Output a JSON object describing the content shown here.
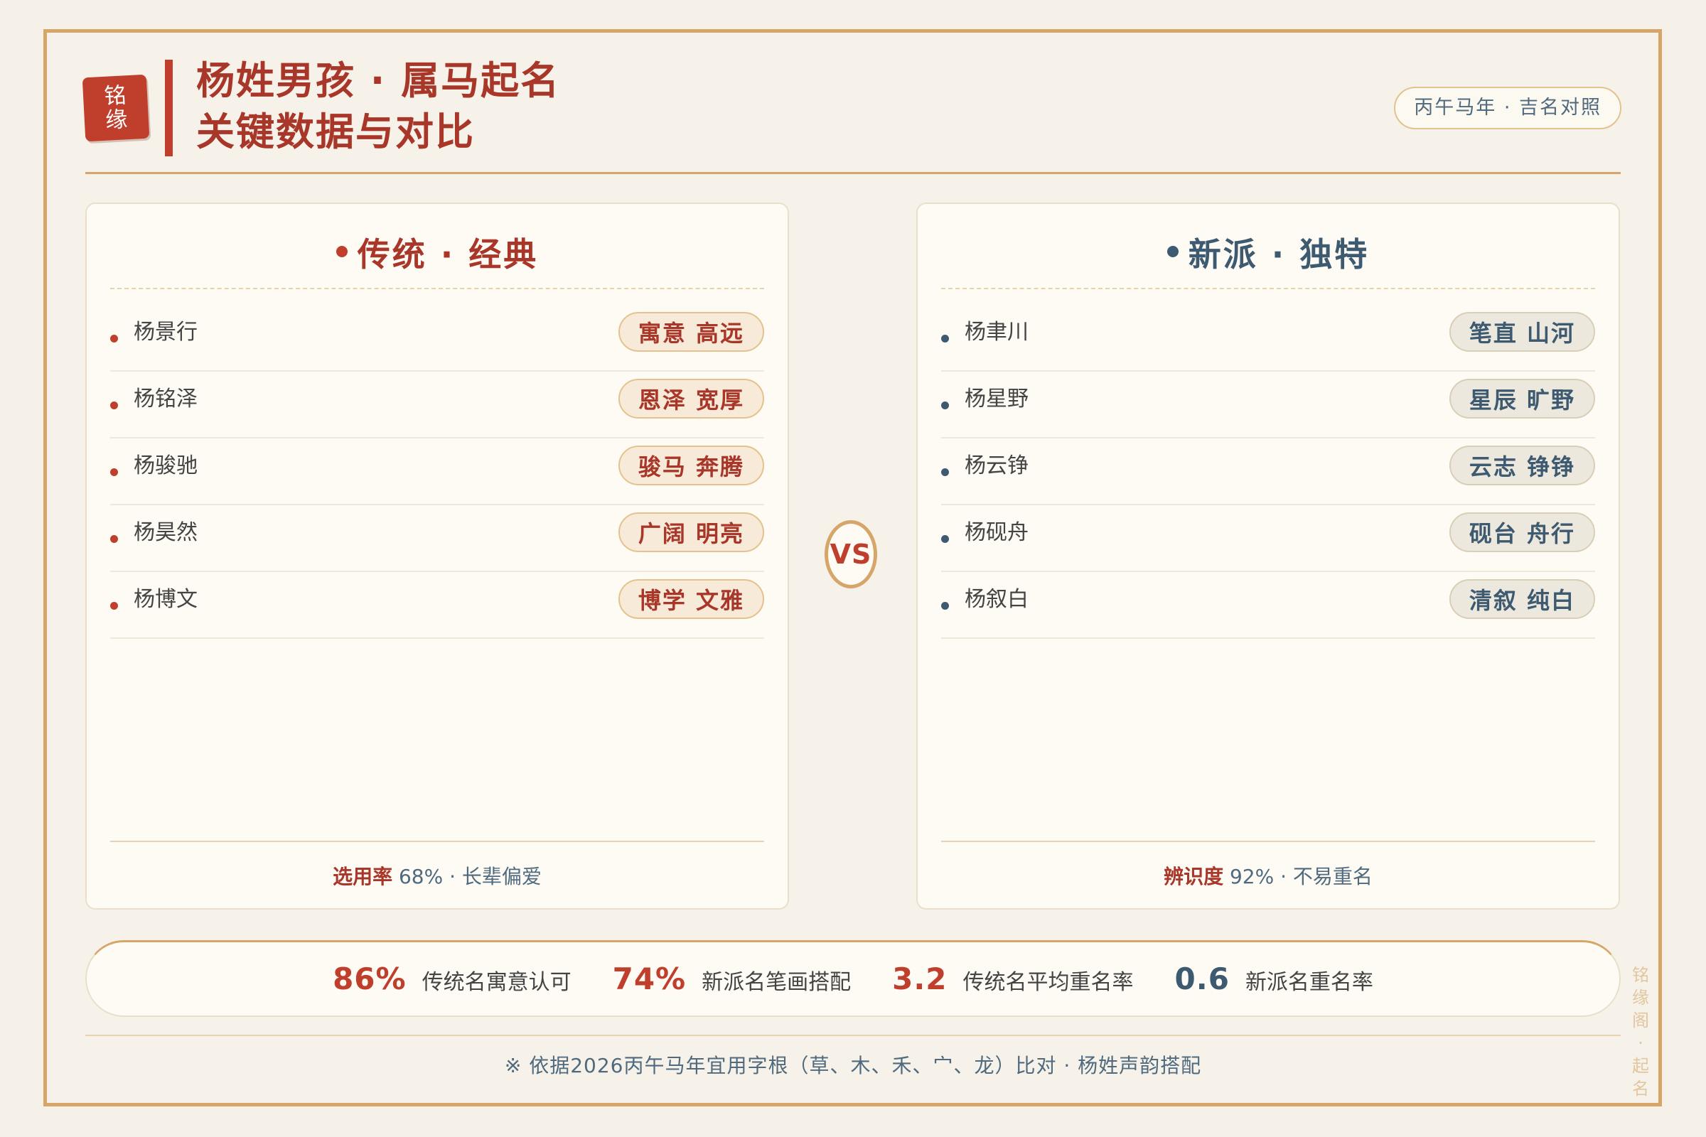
{
  "seal": {
    "line1": "铭",
    "line2": "缘"
  },
  "header": {
    "title_line1": "杨姓男孩 · 属马起名",
    "title_line2": "关键数据与对比",
    "badge": "丙午马年 · 吉名对照"
  },
  "left_panel": {
    "title": "传统 · 经典",
    "rows": [
      {
        "name": "杨景行",
        "tag": "寓意 高远"
      },
      {
        "name": "杨铭泽",
        "tag": "恩泽 宽厚"
      },
      {
        "name": "杨骏驰",
        "tag": "骏马 奔腾"
      },
      {
        "name": "杨昊然",
        "tag": "广阔 明亮"
      },
      {
        "name": "杨博文",
        "tag": "博学 文雅"
      }
    ],
    "footer_key": "选用率",
    "footer_rest": " 68% · 长辈偏爱"
  },
  "vs": "VS",
  "right_panel": {
    "title": "新派 · 独特",
    "rows": [
      {
        "name": "杨聿川",
        "tag": "笔直 山河"
      },
      {
        "name": "杨星野",
        "tag": "星辰 旷野"
      },
      {
        "name": "杨云铮",
        "tag": "云志 铮铮"
      },
      {
        "name": "杨砚舟",
        "tag": "砚台 舟行"
      },
      {
        "name": "杨叙白",
        "tag": "清叙 纯白"
      }
    ],
    "footer_key": "辨识度",
    "footer_rest": " 92% · 不易重名"
  },
  "stats": [
    {
      "value": "86%",
      "label": "传统名寓意认可"
    },
    {
      "value": "74%",
      "label": "新派名笔画搭配"
    },
    {
      "value": "3.2",
      "label": "传统名平均重名率"
    },
    {
      "value": "0.6",
      "label": "新派名重名率"
    }
  ],
  "footnote": "※ 依据2026丙午马年宜用字根（草、木、禾、宀、龙）比对 · 杨姓声韵搭配",
  "side_mark": "铭缘阁·起名",
  "colors": {
    "accent_red": "#bf3f2c",
    "accent_blue": "#3e5a70",
    "gold": "#d6a56a",
    "background": "#f5f1e8"
  }
}
